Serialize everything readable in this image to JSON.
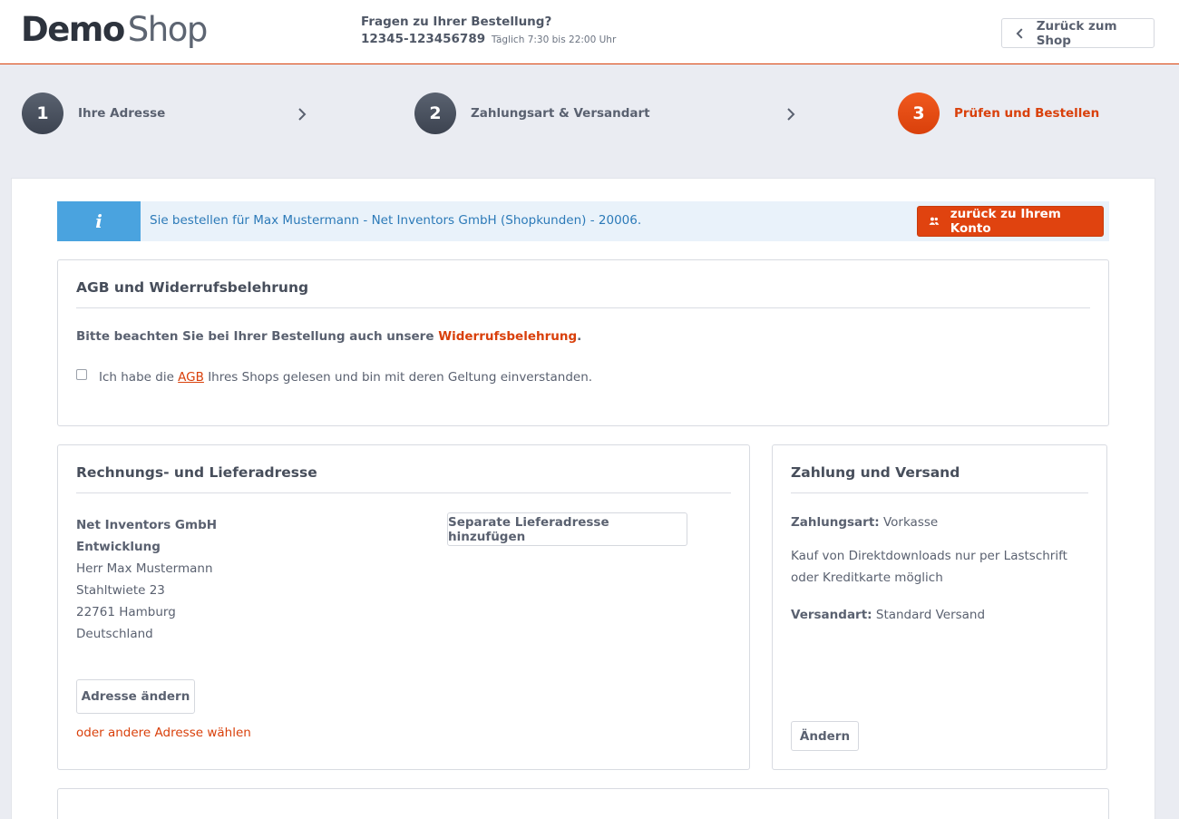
{
  "header": {
    "logo_bold": "Demo",
    "logo_light": "Shop",
    "hotline_question": "Fragen zu Ihrer Bestellung?",
    "hotline_phone": "12345-123456789",
    "hotline_hours": "Täglich 7:30 bis 22:00 Uhr",
    "back_label": "Zurück zum Shop"
  },
  "steps": [
    {
      "number": "1",
      "label": "Ihre Adresse",
      "active": false
    },
    {
      "number": "2",
      "label": "Zahlungsart & Versandart",
      "active": false
    },
    {
      "number": "3",
      "label": "Prüfen und Bestellen",
      "active": true
    }
  ],
  "info_bar": {
    "icon_glyph": "i",
    "message": "Sie bestellen für Max Mustermann - Net Inventors GmbH (Shopkunden) - 20006.",
    "account_button": "zurück zu Ihrem Konto"
  },
  "agb": {
    "title": "AGB und Widerrufsbelehrung",
    "notice_prefix": "Bitte beachten Sie bei Ihrer Bestellung auch unsere ",
    "notice_link": "Widerrufsbelehrung",
    "notice_suffix": ".",
    "checkbox_prefix": "Ich habe die ",
    "checkbox_link": "AGB",
    "checkbox_suffix": " Ihres Shops gelesen und bin mit deren Geltung einverstanden.",
    "checkbox_checked": false
  },
  "address": {
    "title": "Rechnungs- und Lieferadresse",
    "company": "Net Inventors GmbH",
    "department": "Entwicklung",
    "name": "Herr Max Mustermann",
    "street": "Stahltwiete 23",
    "city": "22761 Hamburg",
    "country": "Deutschland",
    "separate_button": "Separate Lieferadresse hinzufügen",
    "change_button": "Adresse ändern",
    "other_link": "oder andere Adresse wählen"
  },
  "payment": {
    "title": "Zahlung und Versand",
    "payment_label": "Zahlungsart:",
    "payment_value": " Vorkasse",
    "download_note": "Kauf von Direktdownloads nur per Lastschrift oder Kreditkarte möglich",
    "shipping_label": "Versandart:",
    "shipping_value": " Standard Versand",
    "edit_button": "Ändern"
  },
  "colors": {
    "accent": "#d9400b",
    "info_blue": "#4aa3df",
    "info_bg": "#e9f2fa",
    "text": "#5a6170",
    "step_dark": "#4a515e"
  }
}
